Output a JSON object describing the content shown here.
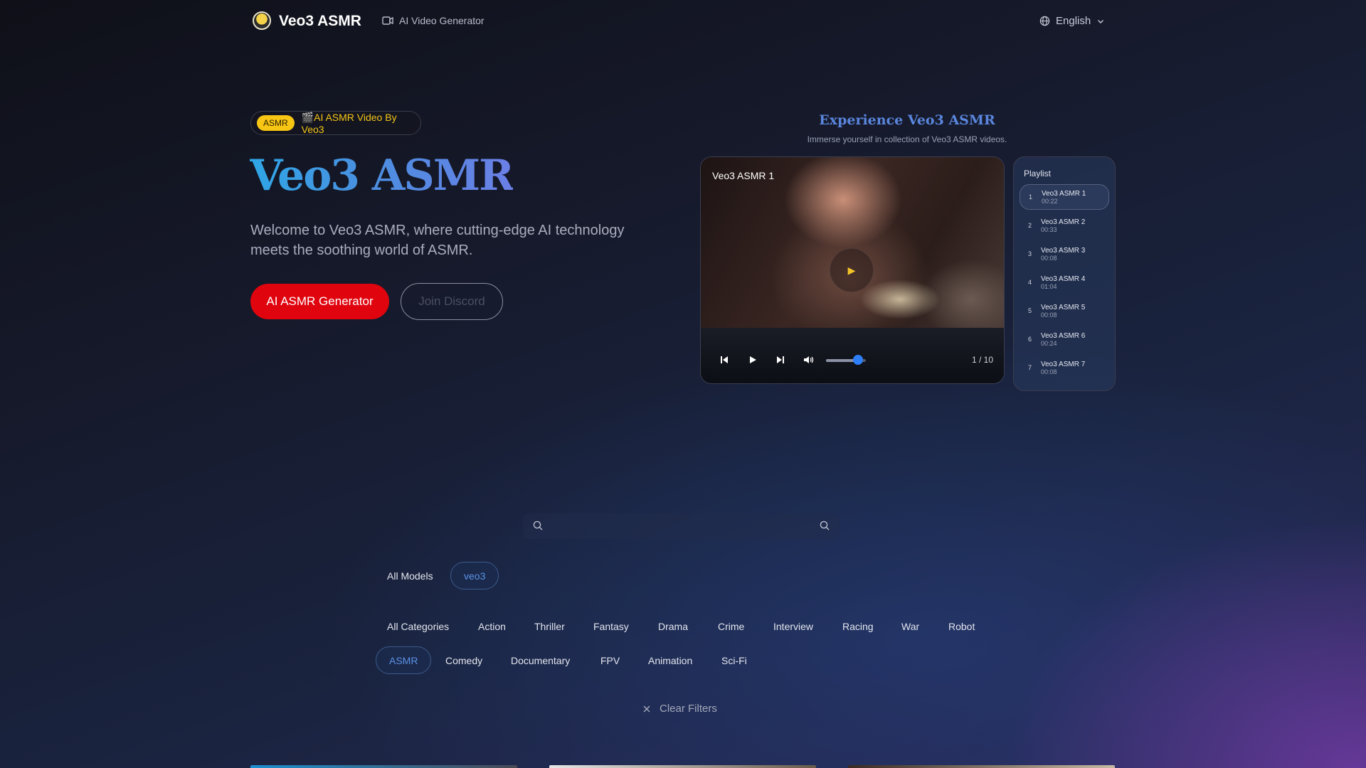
{
  "header": {
    "logo_text": "Veo3 ASMR",
    "nav_link": "AI Video Generator",
    "language": "English"
  },
  "hero": {
    "badge_pill": "ASMR",
    "badge_text": "🎬AI ASMR Video By Veo3",
    "title": "Veo3 ASMR",
    "description": "Welcome to Veo3 ASMR, where cutting-edge AI technology meets the soothing world of ASMR.",
    "primary_button": "AI ASMR Generator",
    "secondary_button": "Join Discord"
  },
  "experience": {
    "title": "Experience Veo3 ASMR",
    "subtitle": "Immerse yourself in collection of Veo3 ASMR videos."
  },
  "player": {
    "current_title": "Veo3 ASMR 1",
    "counter": "1 / 10",
    "volume": 0.8
  },
  "playlist": {
    "title": "Playlist",
    "items": [
      {
        "num": "1",
        "name": "Veo3 ASMR 1",
        "duration": "00:22"
      },
      {
        "num": "2",
        "name": "Veo3 ASMR 2",
        "duration": "00:33"
      },
      {
        "num": "3",
        "name": "Veo3 ASMR 3",
        "duration": "00:08"
      },
      {
        "num": "4",
        "name": "Veo3 ASMR 4",
        "duration": "01:04"
      },
      {
        "num": "5",
        "name": "Veo3 ASMR 5",
        "duration": "00:08"
      },
      {
        "num": "6",
        "name": "Veo3 ASMR 6",
        "duration": "00:24"
      },
      {
        "num": "7",
        "name": "Veo3 ASMR 7",
        "duration": "00:08"
      }
    ]
  },
  "search": {
    "placeholder": ""
  },
  "models": [
    "All Models",
    "veo3"
  ],
  "categories_row1": [
    "All Categories",
    "Action",
    "Thriller",
    "Fantasy",
    "Drama",
    "Crime",
    "Interview",
    "Racing",
    "War",
    "Robot"
  ],
  "categories_row2": [
    "ASMR",
    "Comedy",
    "Documentary",
    "FPV",
    "Animation",
    "Sci-Fi"
  ],
  "clear_filters": "Clear Filters",
  "colors": {
    "primary_red": "#e0040e",
    "accent_blue": "#5b92e6",
    "badge_yellow": "#f7c513"
  }
}
